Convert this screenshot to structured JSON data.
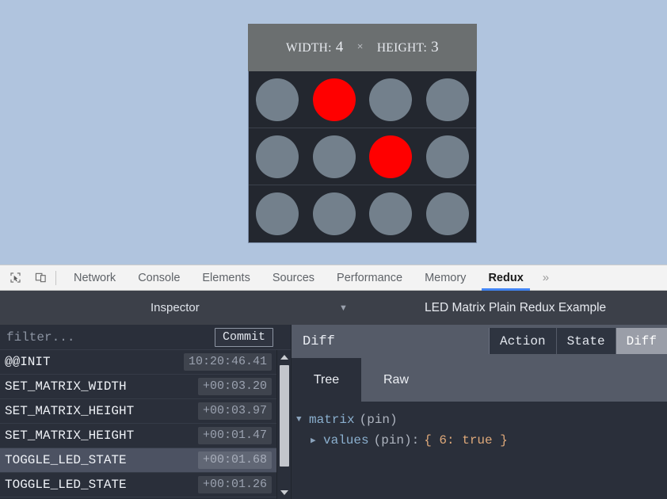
{
  "app": {
    "title": "LED Matrix Plain Redux Example",
    "matrix": {
      "width_label": "WIDTH:",
      "width_value": "4",
      "separator": "×",
      "height_label": "HEIGHT:",
      "height_value": "3",
      "cols": 4,
      "rows": 3,
      "on_cells": [
        1,
        6
      ],
      "led_on_color": "#ff0000",
      "led_off_color": "#73808c",
      "grid_bg": "#23272f",
      "header_bg": "#6b6f70",
      "page_bg": "#b0c4de"
    }
  },
  "devtools": {
    "icons": {
      "inspect": "inspect-element-icon",
      "device": "device-toolbar-icon"
    },
    "tabs": [
      {
        "label": "Network",
        "active": false
      },
      {
        "label": "Console",
        "active": false
      },
      {
        "label": "Elements",
        "active": false
      },
      {
        "label": "Sources",
        "active": false
      },
      {
        "label": "Performance",
        "active": false
      },
      {
        "label": "Memory",
        "active": false
      },
      {
        "label": "Redux",
        "active": true
      }
    ],
    "overflow_label": "»",
    "active_tab_accent": "#4285f4"
  },
  "inspector": {
    "monitor_label": "Inspector",
    "chevron": "▼",
    "instance_title": "LED Matrix Plain Redux Example"
  },
  "actions_panel": {
    "filter_placeholder": "filter...",
    "filter_value": "",
    "commit_label": "Commit",
    "rows": [
      {
        "name": "@@INIT",
        "time": "10:20:46.41",
        "selected": false
      },
      {
        "name": "SET_MATRIX_WIDTH",
        "time": "+00:03.20",
        "selected": false
      },
      {
        "name": "SET_MATRIX_HEIGHT",
        "time": "+00:03.97",
        "selected": false
      },
      {
        "name": "SET_MATRIX_HEIGHT",
        "time": "+00:01.47",
        "selected": false
      },
      {
        "name": "TOGGLE_LED_STATE",
        "time": "+00:01.68",
        "selected": true
      },
      {
        "name": "TOGGLE_LED_STATE",
        "time": "+00:01.26",
        "selected": false
      }
    ]
  },
  "detail_panel": {
    "title": "Diff",
    "modes": [
      {
        "label": "Action",
        "active": false
      },
      {
        "label": "State",
        "active": false
      },
      {
        "label": "Diff",
        "active": true
      }
    ],
    "subtabs": [
      {
        "label": "Tree",
        "active": true
      },
      {
        "label": "Raw",
        "active": false
      }
    ],
    "tree": [
      {
        "level": 0,
        "arrow": "▼",
        "key": "matrix",
        "meta": "(pin)",
        "punct": "",
        "value": ""
      },
      {
        "level": 1,
        "arrow": "▶",
        "key": "values",
        "meta": "(pin):",
        "punct": "",
        "value": "{ 6: true }"
      }
    ]
  }
}
